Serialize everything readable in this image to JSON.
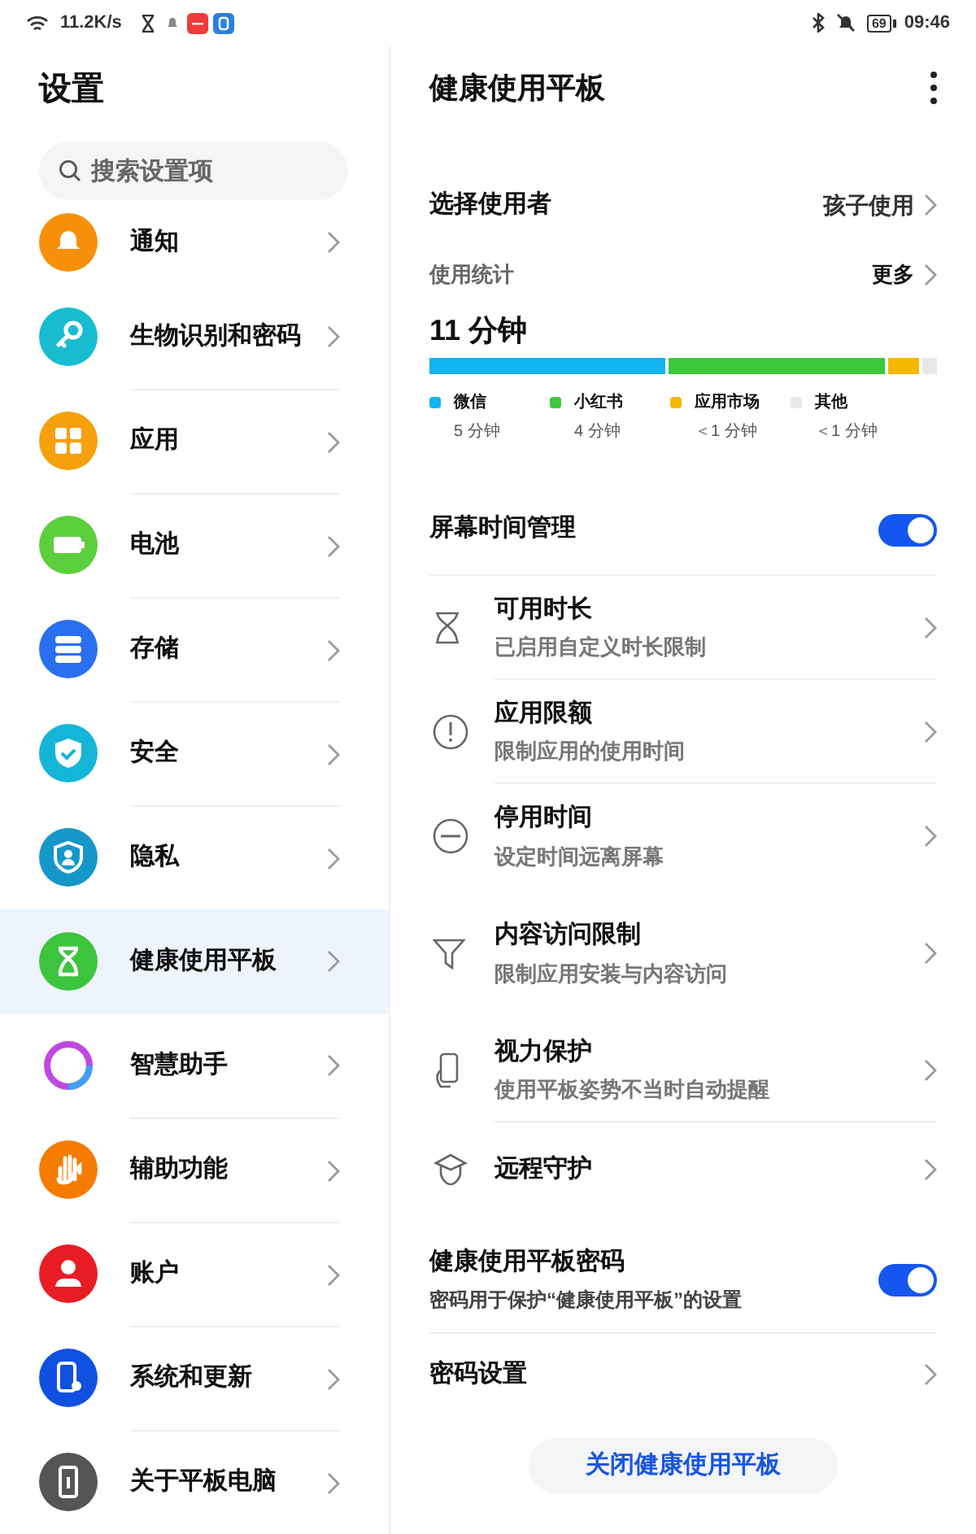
{
  "status_bar": {
    "network_speed": "11.2K/s",
    "battery": "69",
    "time": "09:46"
  },
  "sidebar": {
    "title": "设置",
    "search": {
      "placeholder": "搜索设置项"
    },
    "items": [
      {
        "label": "通知",
        "selected": false
      },
      {
        "label": "生物识别和密码",
        "selected": false
      },
      {
        "label": "应用",
        "selected": false
      },
      {
        "label": "电池",
        "selected": false
      },
      {
        "label": "存储",
        "selected": false
      },
      {
        "label": "安全",
        "selected": false
      },
      {
        "label": "隐私",
        "selected": false
      },
      {
        "label": "健康使用平板",
        "selected": true
      },
      {
        "label": "智慧助手",
        "selected": false
      },
      {
        "label": "辅助功能",
        "selected": false
      },
      {
        "label": "账户",
        "selected": false
      },
      {
        "label": "系统和更新",
        "selected": false
      },
      {
        "label": "关于平板电脑",
        "selected": false
      }
    ]
  },
  "detail": {
    "title": "健康使用平板",
    "user_row": {
      "label": "选择使用者",
      "value": "孩子使用"
    },
    "usage": {
      "title": "使用统计",
      "more": "更多",
      "total": "11 分钟",
      "segments": [
        {
          "label": "微信",
          "time": "5 分钟",
          "color": "#12b4f0"
        },
        {
          "label": "小红书",
          "time": "4 分钟",
          "color": "#3cc93c"
        },
        {
          "label": "应用市场",
          "time": "＜1 分钟",
          "color": "#f5b800"
        },
        {
          "label": "其他",
          "time": "＜1 分钟",
          "color": "#e8e8e8"
        }
      ]
    },
    "screen_time": {
      "label": "屏幕时间管理",
      "on": true
    },
    "items": [
      {
        "title": "可用时长",
        "subtitle": "已启用自定义时长限制"
      },
      {
        "title": "应用限额",
        "subtitle": "限制应用的使用时间"
      },
      {
        "title": "停用时间",
        "subtitle": "设定时间远离屏幕"
      },
      {
        "title": "内容访问限制",
        "subtitle": "限制应用安装与内容访问"
      },
      {
        "title": "视力保护",
        "subtitle": "使用平板姿势不当时自动提醒"
      },
      {
        "title": "远程守护"
      }
    ],
    "password": {
      "title": "健康使用平板密码",
      "subtitle": "密码用于保护“健康使用平板”的设置",
      "on": true
    },
    "password_settings": "密码设置",
    "close_button": "关闭健康使用平板"
  }
}
